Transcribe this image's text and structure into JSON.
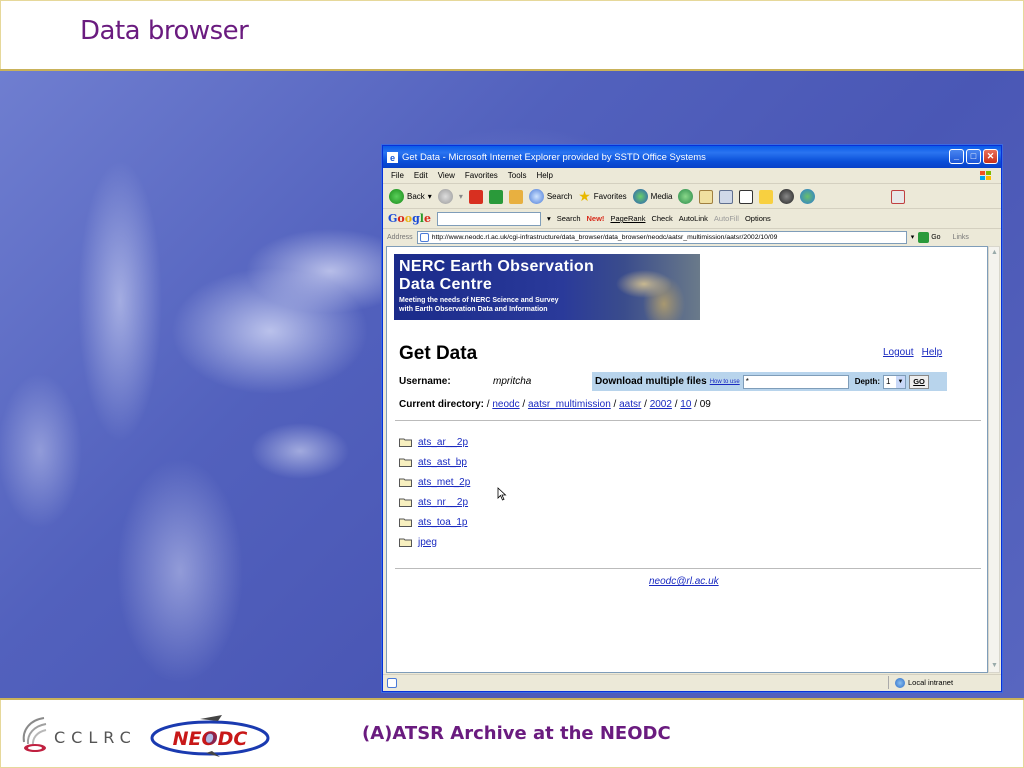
{
  "slide": {
    "title": "Data browser",
    "footer_caption": "(A)ATSR Archive at the NEODC",
    "logo_left_text": "CCLRC",
    "logo_right_text": "NEODC"
  },
  "browser": {
    "title": "Get Data - Microsoft Internet Explorer provided by SSTD Office Systems",
    "menu": [
      "File",
      "Edit",
      "View",
      "Favorites",
      "Tools",
      "Help"
    ],
    "toolbar": {
      "back": "Back",
      "search": "Search",
      "favorites": "Favorites",
      "media": "Media"
    },
    "google_bar": {
      "logo": "Google",
      "search_label": "Search",
      "pagerank": "PageRank",
      "check": "Check",
      "autolink": "AutoLink",
      "autofill": "AutoFill",
      "options": "Options"
    },
    "address": {
      "label": "Address",
      "url": "http://www.neodc.rl.ac.uk/cgi-infrastructure/data_browser/data_browser/neodc/aatsr_multimission/aatsr/2002/10/09",
      "go": "Go",
      "links": "Links"
    },
    "status": {
      "zone": "Local intranet"
    }
  },
  "page": {
    "banner": {
      "line1": "NERC Earth Observation",
      "line2": "Data Centre",
      "tagline1": "Meeting the needs of NERC Science and Survey",
      "tagline2": "with Earth Observation Data and Information"
    },
    "heading": "Get Data",
    "logout": "Logout",
    "help": "Help",
    "username_label": "Username:",
    "username_value": "mpritcha",
    "download": {
      "label": "Download multiple files",
      "howto": "How to use",
      "pattern_value": "*",
      "depth_label": "Depth:",
      "depth_value": "1",
      "go": "GO"
    },
    "current_directory": {
      "label": "Current directory:",
      "root": "/",
      "segments": [
        "neodc",
        "aatsr_multimission",
        "aatsr",
        "2002",
        "10"
      ],
      "separator": "/",
      "current": "09"
    },
    "directories": [
      "ats_ar__2p",
      "ats_ast_bp",
      "ats_met_2p",
      "ats_nr__2p",
      "ats_toa_1p",
      "jpeg"
    ],
    "contact_email": "neodc@rl.ac.uk"
  },
  "colors": {
    "slide_title": "#6a1b7f",
    "link": "#1a2ac0",
    "titlebar": "#0a5ce8",
    "download_box": "#b8d4ec"
  }
}
